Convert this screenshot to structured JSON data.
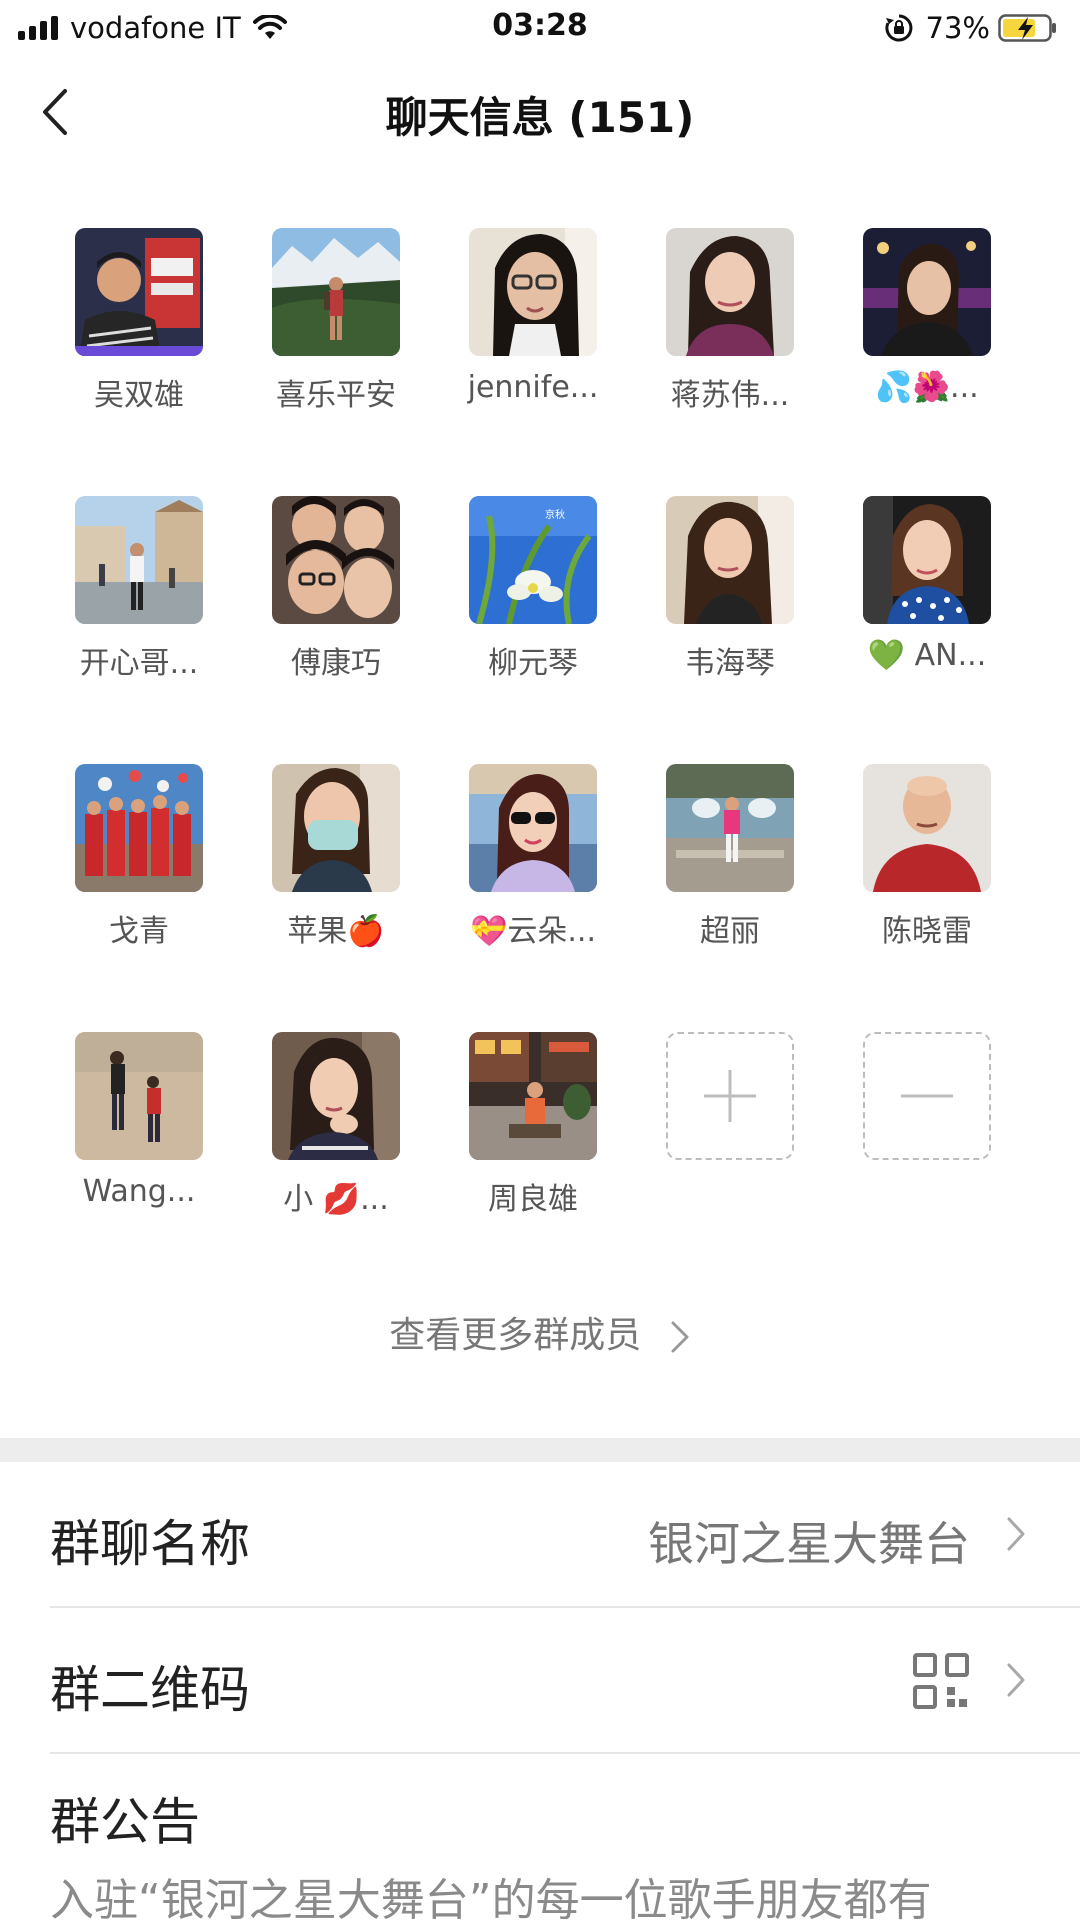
{
  "status_bar": {
    "carrier": "vodafone IT",
    "time": "03:28",
    "battery_percent": "73%",
    "battery_level": 0.73,
    "icons": [
      "signal-icon",
      "wifi-icon",
      "rotation-lock-icon",
      "battery-charging-icon"
    ]
  },
  "nav": {
    "title": "聊天信息 (151)",
    "back_icon": "back-chevron-icon"
  },
  "members": [
    {
      "name": "吴双雄",
      "avatar": "man-office"
    },
    {
      "name": "喜乐平安",
      "avatar": "mountain-hiker"
    },
    {
      "name": "jennife...",
      "avatar": "woman-glasses"
    },
    {
      "name": "蒋苏伟...",
      "avatar": "woman-purple"
    },
    {
      "name": "💦🌺...",
      "avatar": "woman-night"
    },
    {
      "name": "开心哥...",
      "avatar": "man-plaza"
    },
    {
      "name": "傅康巧",
      "avatar": "group-selfie"
    },
    {
      "name": "柳元琴",
      "avatar": "flowers-sky"
    },
    {
      "name": "韦海琴",
      "avatar": "woman-longhair"
    },
    {
      "name": "💚 AN...",
      "avatar": "woman-polka"
    },
    {
      "name": "戈青",
      "avatar": "red-group"
    },
    {
      "name": "苹果🍎",
      "avatar": "woman-mask"
    },
    {
      "name": "💝云朵...",
      "avatar": "woman-sunglasses"
    },
    {
      "name": "超丽",
      "avatar": "fountain-woman"
    },
    {
      "name": "陈晓雷",
      "avatar": "bald-man"
    },
    {
      "name": "Wang...",
      "avatar": "beach-couple"
    },
    {
      "name": "小 💋...",
      "avatar": "woman-smile"
    },
    {
      "name": "周良雄",
      "avatar": "man-street"
    }
  ],
  "add_member_label": "+",
  "remove_member_label": "−",
  "more_members_label": "查看更多群成员",
  "rows": {
    "group_name": {
      "label": "群聊名称",
      "value": "银河之星大舞台"
    },
    "group_qr": {
      "label": "群二维码"
    },
    "notice": {
      "label": "群公告",
      "text": "入驻“银河之星大舞台”的每一位歌手朋友都有"
    }
  },
  "colors": {
    "background": "#ffffff",
    "section_gap": "#ededed",
    "secondary_text": "#777777",
    "battery_fill": "#f5d63c"
  }
}
